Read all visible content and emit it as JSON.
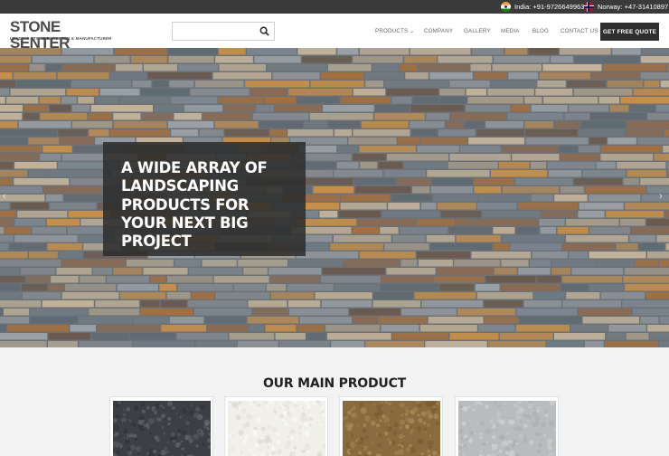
{
  "topbar": {
    "india": {
      "flag": "india-flag-icon",
      "text": "India: +91-9726649963"
    },
    "norway": {
      "flag": "norway-flag-icon",
      "text": "Norway: +47-31410897"
    }
  },
  "header": {
    "logo_text": "STONE SENTER",
    "logo_tagline": "LEADING STONE EXPORTER & MANUFACTURER",
    "search_placeholder": "",
    "nav": [
      {
        "label": "PRODUCTS"
      },
      {
        "label": "COMPANY"
      },
      {
        "label": "GALLERY"
      },
      {
        "label": "MEDIA"
      },
      {
        "label": "BLOG"
      },
      {
        "label": "CONTACT US"
      }
    ],
    "cta_label": "GET FREE QUOTE"
  },
  "hero": {
    "headline": "A WIDE ARRAY OF LANDSCAPING PRODUCTS FOR YOUR NEXT BIG PROJECT"
  },
  "products": {
    "section_title": "OUR MAIN PRODUCT",
    "cards": [
      {
        "swatch": "granite-dark"
      },
      {
        "swatch": "marble-white"
      },
      {
        "swatch": "sandstone-brown"
      },
      {
        "swatch": "limestone-grey"
      }
    ]
  },
  "colors": {
    "topbar_bg": "#3a3a3a",
    "cta_bg": "#2e2e2e",
    "hero_overlay": "#2d2d2d"
  }
}
